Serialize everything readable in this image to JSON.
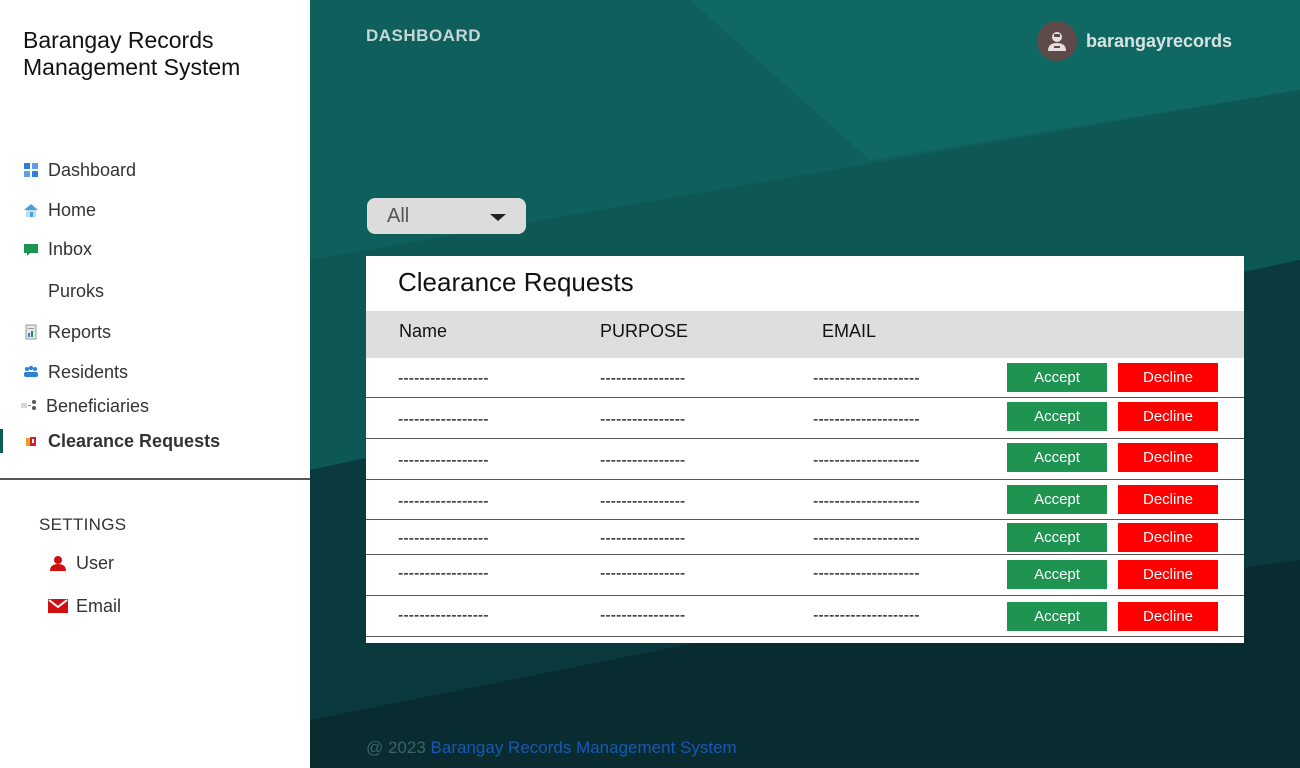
{
  "app": {
    "title": "Barangay Records Management System"
  },
  "sidebar": {
    "items": [
      {
        "label": "Dashboard",
        "icon": "dashboard-icon"
      },
      {
        "label": "Home",
        "icon": "home-icon"
      },
      {
        "label": "Inbox",
        "icon": "inbox-icon"
      },
      {
        "label": "Puroks",
        "icon": ""
      },
      {
        "label": "Reports",
        "icon": "reports-icon"
      },
      {
        "label": "Residents",
        "icon": "residents-icon"
      },
      {
        "label": "Beneficiaries",
        "icon": "beneficiaries-icon"
      },
      {
        "label": "Clearance Requests",
        "icon": "clearance-icon"
      }
    ],
    "active": "Clearance Requests",
    "settings": {
      "label": "SETTINGS",
      "items": [
        {
          "label": "User",
          "icon": "user-icon"
        },
        {
          "label": "Email",
          "icon": "email-icon"
        }
      ]
    }
  },
  "header": {
    "title": "DASHBOARD",
    "username": "barangayrecords"
  },
  "filter": {
    "selected": "All"
  },
  "table": {
    "title": "Clearance Requests",
    "columns": [
      "Name",
      "PURPOSE",
      "EMAIL"
    ],
    "rows": [
      {
        "name": "-----------------",
        "purpose": "----------------",
        "email": "--------------------"
      },
      {
        "name": "-----------------",
        "purpose": "----------------",
        "email": "--------------------"
      },
      {
        "name": "-----------------",
        "purpose": "----------------",
        "email": "--------------------"
      },
      {
        "name": "-----------------",
        "purpose": "----------------",
        "email": "--------------------"
      },
      {
        "name": "-----------------",
        "purpose": "----------------",
        "email": "--------------------"
      },
      {
        "name": "-----------------",
        "purpose": "----------------",
        "email": "--------------------"
      },
      {
        "name": "-----------------",
        "purpose": "----------------",
        "email": "--------------------"
      }
    ],
    "accept_label": "Accept",
    "decline_label": "Decline"
  },
  "footer": {
    "copyright": "@ 2023",
    "link_text": "Barangay Records Management System"
  },
  "colors": {
    "accent": "#0d5c55",
    "accept": "#1f9450",
    "decline": "#ff0000",
    "background": "#0a3a3a"
  }
}
